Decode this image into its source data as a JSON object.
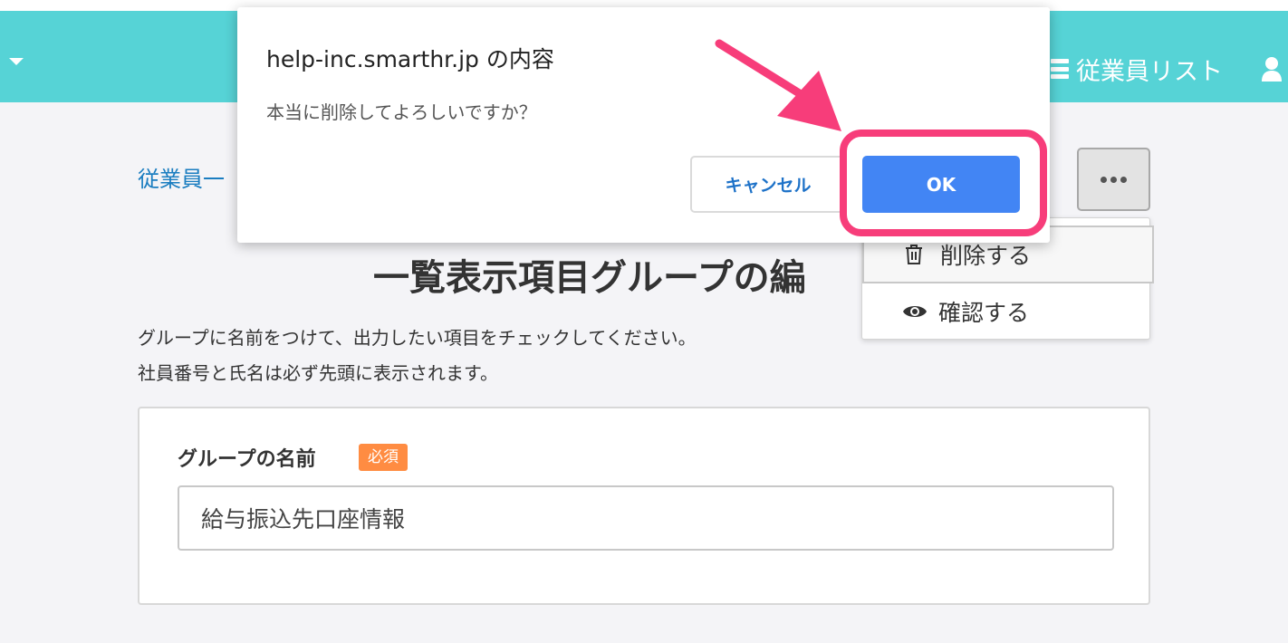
{
  "header": {
    "nav_label": "従業員リスト",
    "bg_color": "#56d3d6"
  },
  "breadcrumb": {
    "label": "従業員一"
  },
  "page": {
    "title": "一覧表示項目グループの編",
    "description_lines": [
      "グループに名前をつけて、出力したい項目をチェックしてください。",
      "社員番号と氏名は必ず先頭に表示されます。"
    ]
  },
  "more_menu": {
    "items": [
      {
        "label": "削除する",
        "icon": "trash-icon"
      },
      {
        "label": "確認する",
        "icon": "eye-icon"
      }
    ]
  },
  "form": {
    "group_name_label": "グループの名前",
    "required_badge": "必須",
    "group_name_value": "給与振込先口座情報"
  },
  "dialog": {
    "title": "help-inc.smarthr.jp の内容",
    "message": "本当に削除してよろしいですか？",
    "cancel_label": "キャンセル",
    "ok_label": "OK"
  },
  "colors": {
    "accent": "#4285f4",
    "annotation": "#f73d7a",
    "badge": "#ff8c42",
    "link": "#1a7dc0"
  }
}
